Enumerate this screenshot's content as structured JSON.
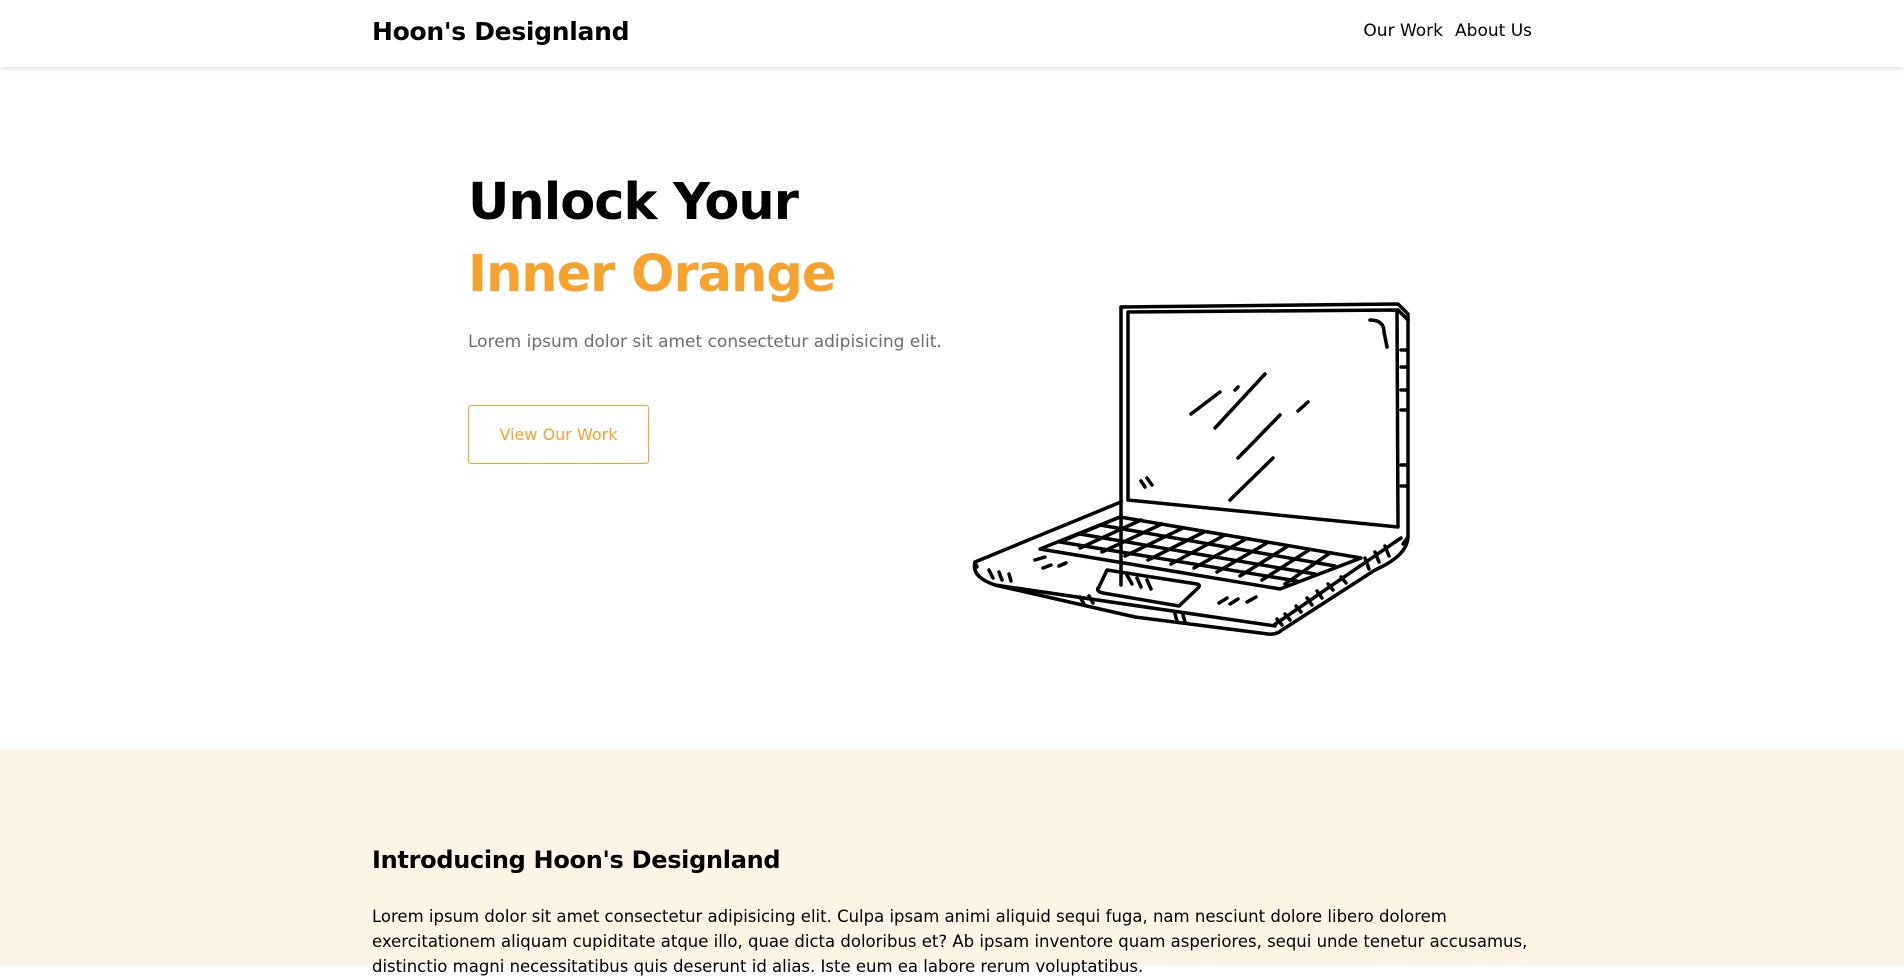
{
  "header": {
    "logo": "Hoon's Designland",
    "nav": [
      {
        "label": "Our Work"
      },
      {
        "label": "About Us"
      }
    ]
  },
  "hero": {
    "title_line1": "Unlock Your",
    "title_line2": "Inner Orange",
    "subtitle": "Lorem ipsum dolor sit amet consectetur adipisicing elit.",
    "cta_label": "View Our Work",
    "illustration": "laptop-illustration"
  },
  "intro": {
    "title": "Introducing Hoon's Designland",
    "body": "Lorem ipsum dolor sit amet consectetur adipisicing elit. Culpa ipsam animi aliquid sequi fuga, nam nesciunt dolore libero dolorem exercitationem aliquam cupiditate atque illo, quae dicta doloribus et? Ab ipsam inventore quam asperiores, sequi unde tenetur accusamus, distinctio magni necessitatibus quis deserunt id alias. Iste eum ea labore rerum voluptatibus."
  },
  "colors": {
    "accent": "#f7a22d",
    "intro_background": "#fef4e6",
    "subtitle_text": "#6e6e6e"
  }
}
